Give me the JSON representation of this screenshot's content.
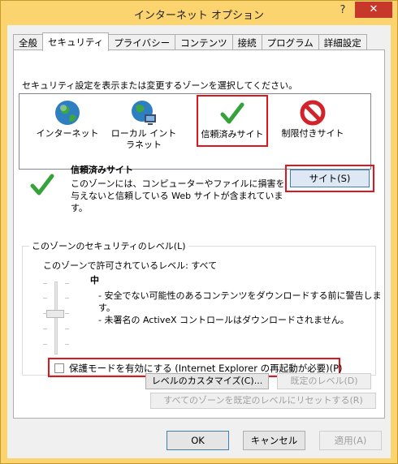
{
  "window": {
    "title": "インターネット オプション",
    "help_glyph": "?",
    "close_glyph": "✕"
  },
  "tabs": [
    {
      "label": "全般"
    },
    {
      "label": "セキュリティ"
    },
    {
      "label": "プライバシー"
    },
    {
      "label": "コンテンツ"
    },
    {
      "label": "接続"
    },
    {
      "label": "プログラム"
    },
    {
      "label": "詳細設定"
    }
  ],
  "zones": {
    "instruction": "セキュリティ設定を表示または変更するゾーンを選択してください。",
    "items": [
      {
        "label": "インターネット",
        "icon": "globe-icon"
      },
      {
        "label": "ローカル イントラネット",
        "icon": "intranet-globe-icon"
      },
      {
        "label": "信頼済みサイト",
        "icon": "check-icon"
      },
      {
        "label": "制限付きサイト",
        "icon": "restricted-icon"
      }
    ],
    "selected_index": 2
  },
  "zone_info": {
    "title": "信頼済みサイト",
    "description": "このゾーンには、コンピューターやファイルに損害を与えないと信頼している Web サイトが含まれています。",
    "sites_button": "サイト(S)"
  },
  "security_level": {
    "legend": "このゾーンのセキュリティのレベル(L)",
    "allowed": "このゾーンで許可されているレベル: すべて",
    "level_name": "中",
    "bullets": [
      "- 安全でない可能性のあるコンテンツをダウンロードする前に警告します。",
      "- 未署名の ActiveX コントロールはダウンロードされません。"
    ],
    "protected_mode_label": "保護モードを有効にする (Internet Explorer の再起動が必要)(P)",
    "protected_mode_checked": false,
    "custom_level_button": "レベルのカスタマイズ(C)...",
    "default_level_button": "既定のレベル(D)",
    "reset_all_button": "すべてのゾーンを既定のレベルにリセットする(R)"
  },
  "footer": {
    "ok": "OK",
    "cancel": "キャンセル",
    "apply": "適用(A)"
  }
}
